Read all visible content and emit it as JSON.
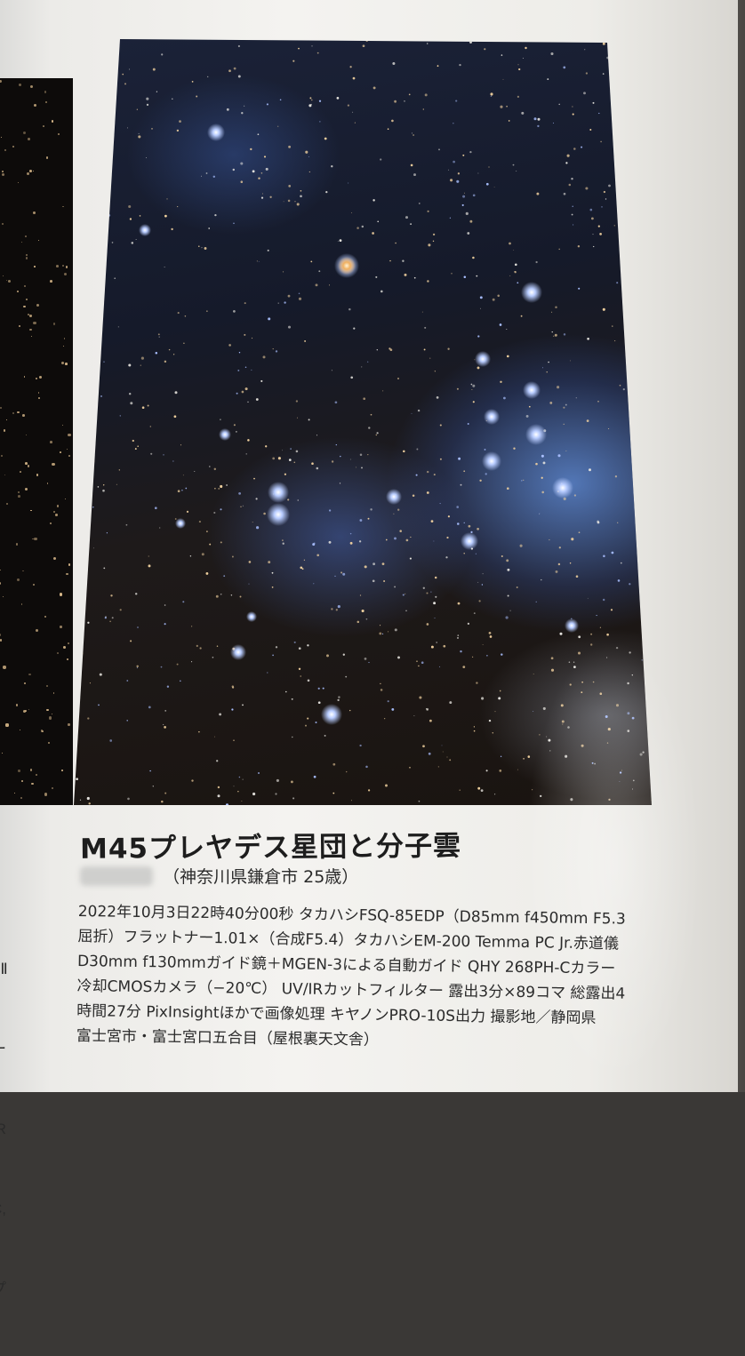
{
  "article": {
    "title": "M45プレヤデス星団と分子雲",
    "credit": "（神奈川県鎌倉市  25歳）",
    "body_lines": [
      "2022年10月3日22時40分00秒  タカハシFSQ-85EDP（D85mm f450mm F5.3",
      "屈折）フラットナー1.01×（合成F5.4）タカハシEM-200 Temma PC Jr.赤道儀",
      "D30mm f130mmガイド鏡＋MGEN-3による自動ガイド  QHY 268PH-Cカラー",
      "冷却CMOSカメラ（−20℃）  UV/IRカットフィルター  露出3分×89コマ  総露出4",
      "時間27分  PixInsightほかで画像処理  キヤノンPRO-10S出力  撮影地／静岡県",
      "富士宮市・富士宮口五合目（屋根裏天文舎）"
    ]
  },
  "left_page_fragments": [
    "TⅡ",
    "ー",
    "IR",
    "C,",
    "プ"
  ],
  "colors": {
    "nebula_blue": "#6d96eb",
    "star_blue": "#b8ccff",
    "star_gold": "#f0b060",
    "paper": "#f2f1ee",
    "ink": "#222222"
  }
}
